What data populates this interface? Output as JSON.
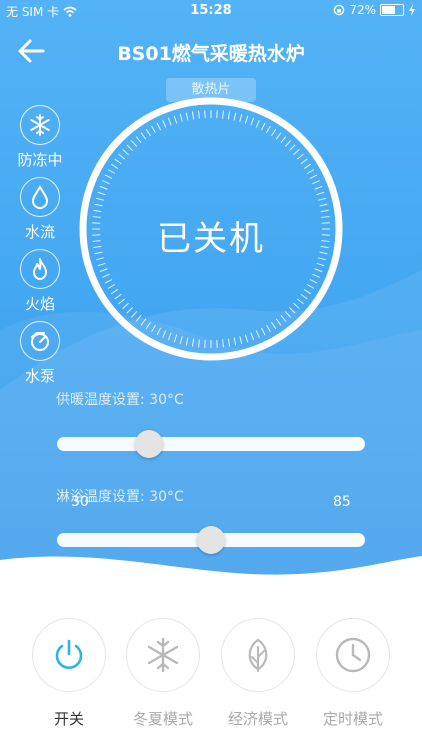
{
  "status_bar": {
    "carrier": "无 SIM 卡",
    "time": "15:28",
    "battery_percent": "72%",
    "battery_level": 0.72
  },
  "nav": {
    "title": "BS01燃气采暖热水炉"
  },
  "side_indicators": [
    {
      "label": "防冻中",
      "icon": "snowflake-icon"
    },
    {
      "label": "水流",
      "icon": "water-drop-icon"
    },
    {
      "label": "火焰",
      "icon": "flame-icon"
    },
    {
      "label": "水泵",
      "icon": "pump-icon"
    }
  ],
  "dial": {
    "tag": "散热片",
    "status": "已关机"
  },
  "heating_slider": {
    "label": "供暖温度设置: 30°C",
    "value": 30,
    "min": 30,
    "max": 85,
    "position_fraction": 0.28
  },
  "shower_slider": {
    "label": "淋浴温度设置: 30°C",
    "min_label": "30",
    "max_label": "85",
    "position_fraction": 0.5
  },
  "bottom_bar": [
    {
      "label": "开关",
      "icon": "power-icon",
      "active": true
    },
    {
      "label": "冬夏模式",
      "icon": "snowflake-icon",
      "active": false
    },
    {
      "label": "经济模式",
      "icon": "leaf-icon",
      "active": false
    },
    {
      "label": "定时模式",
      "icon": "clock-icon",
      "active": false
    }
  ],
  "colors": {
    "background_blue": "#45a8f2",
    "active_icon": "#2cb3e8",
    "inactive_icon": "#b9b9b9",
    "active_label": "#333333",
    "inactive_label": "#aaaaaa"
  }
}
